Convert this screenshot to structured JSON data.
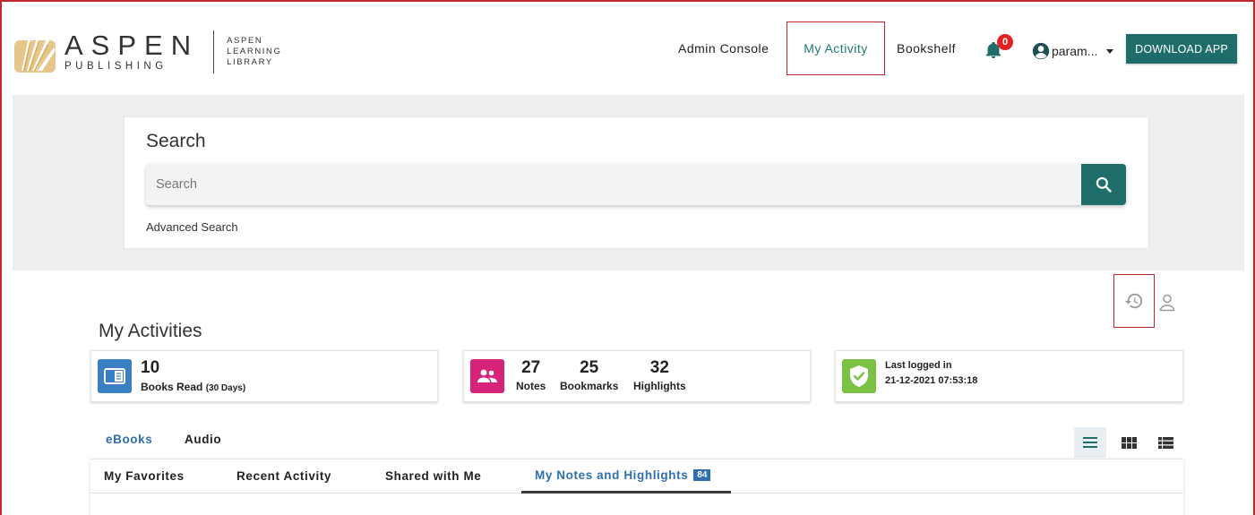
{
  "brand": {
    "name": "ASPEN",
    "sub": "PUBLISHING",
    "library_line1": "ASPEN",
    "library_line2": "LEARNING",
    "library_line3": "LIBRARY",
    "accent_color": "#d9a84e"
  },
  "nav": {
    "admin_console": "Admin Console",
    "my_activity": "My Activity",
    "bookshelf": "Bookshelf",
    "notification_count": "0",
    "user_name": "param...",
    "download_app": "DOWNLOAD APP"
  },
  "search": {
    "title": "Search",
    "placeholder": "Search",
    "advanced": "Advanced Search"
  },
  "activities": {
    "title": "My Activities",
    "books_read_count": "10",
    "books_read_label": "Books Read",
    "books_read_period": "(30 Days)",
    "notes_count": "27",
    "notes_label": "Notes",
    "bookmarks_count": "25",
    "bookmarks_label": "Bookmarks",
    "highlights_count": "32",
    "highlights_label": "Highlights",
    "last_logged_label": "Last logged in",
    "last_logged_value": "21-12-2021 07:53:18"
  },
  "tabs": {
    "ebooks": "eBooks",
    "audio": "Audio"
  },
  "subtabs": {
    "favorites": "My Favorites",
    "recent": "Recent Activity",
    "shared": "Shared with Me",
    "notes_highlights": "My Notes and Highlights",
    "notes_highlights_count": "84"
  },
  "colors": {
    "primary": "#1f6d6b",
    "link_blue": "#2f6fb0",
    "highlight_border": "#c0282d",
    "books_icon": "#3a7fc1",
    "notes_icon": "#d6247a",
    "login_icon": "#7bc143"
  }
}
